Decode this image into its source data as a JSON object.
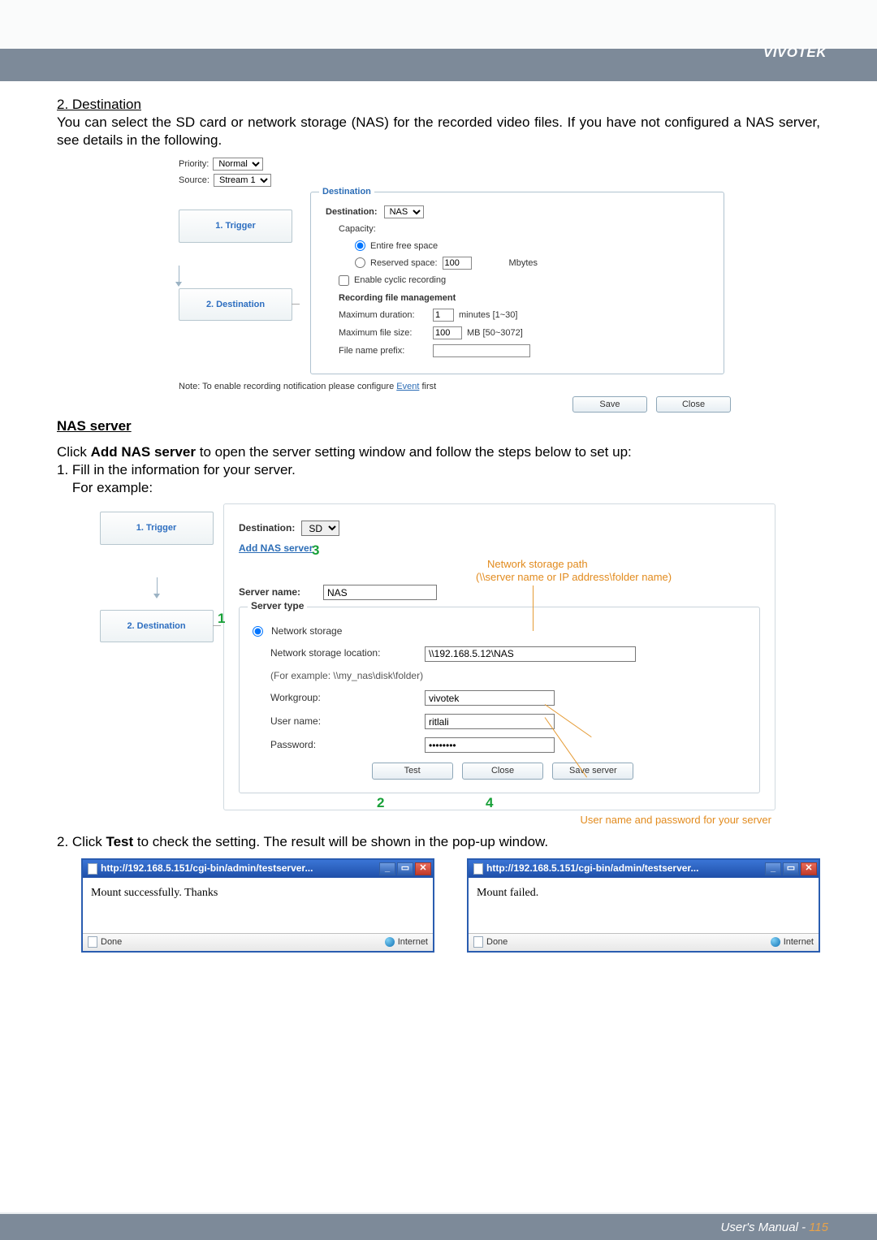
{
  "brand": "VIVOTEK",
  "section2": {
    "heading": "2. Destination",
    "para": "You can select the SD card or network storage (NAS) for the recorded video files. If you have not configured a NAS server, see details in the following."
  },
  "shot1": {
    "priority_label": "Priority:",
    "priority_value": "Normal",
    "source_label": "Source:",
    "source_value": "Stream 1",
    "nav": {
      "trigger": "1.  Trigger",
      "destination": "2.  Destination"
    },
    "legend": "Destination",
    "dest_label": "Destination:",
    "dest_value": "NAS",
    "capacity_label": "Capacity:",
    "capacity_opt1": "Entire free space",
    "capacity_opt2": "Reserved space:",
    "capacity_opt2_value": "100",
    "capacity_opt2_unit": "Mbytes",
    "cyclic_label": "Enable cyclic recording",
    "rfm_header": "Recording file management",
    "max_dur_label": "Maximum duration:",
    "max_dur_value": "1",
    "max_dur_unit": "minutes [1~30]",
    "max_size_label": "Maximum file size:",
    "max_size_value": "100",
    "max_size_unit": "MB [50~3072]",
    "prefix_label": "File name prefix:",
    "note_pre": "Note: To enable recording notification please configure ",
    "note_link": "Event",
    "note_post": " first",
    "save": "Save",
    "close": "Close"
  },
  "nas_section": {
    "heading": "NAS server",
    "line1_pre": "Click ",
    "line1_strong": "Add NAS server",
    "line1_post": " to open the server setting window and follow the steps below to set up:",
    "line2": "1. Fill in the information for your server.",
    "line3": "    For example:"
  },
  "shot2": {
    "nav": {
      "trigger": "1.  Trigger",
      "destination": "2.  Destination"
    },
    "dest_label": "Destination:",
    "dest_value": "SD",
    "add_link": "Add NAS server",
    "server_name_label": "Server name:",
    "server_name_value": "NAS",
    "server_type_legend": "Server type",
    "radio_net": "Network storage",
    "loc_label": "Network storage location:",
    "loc_value": "\\\\192.168.5.12\\NAS",
    "loc_example": "(For example: \\\\my_nas\\disk\\folder)",
    "wg_label": "Workgroup:",
    "wg_value": "vivotek",
    "user_label": "User name:",
    "user_value": "ritlali",
    "pwd_label": "Password:",
    "pwd_value": "••••••••",
    "btn_test": "Test",
    "btn_close": "Close",
    "btn_save": "Save server",
    "callout_path_title": "Network storage path",
    "callout_path_sub": "(\\\\server name or IP address\\folder name)",
    "callout_user_pwd": "User name and password for your server",
    "n1": "1",
    "n2": "2",
    "n3": "3",
    "n4": "4"
  },
  "line_test": {
    "pre": "2. Click ",
    "strong": "Test",
    "post": " to check the setting. The result will be shown in the pop-up window."
  },
  "popup": {
    "url": "http://192.168.5.151/cgi-bin/admin/testserver...",
    "success_body": "Mount successfully. Thanks",
    "fail_body": "Mount failed.",
    "done": "Done",
    "internet": "Internet"
  },
  "footer": {
    "text": "User's Manual - ",
    "page": "115"
  }
}
